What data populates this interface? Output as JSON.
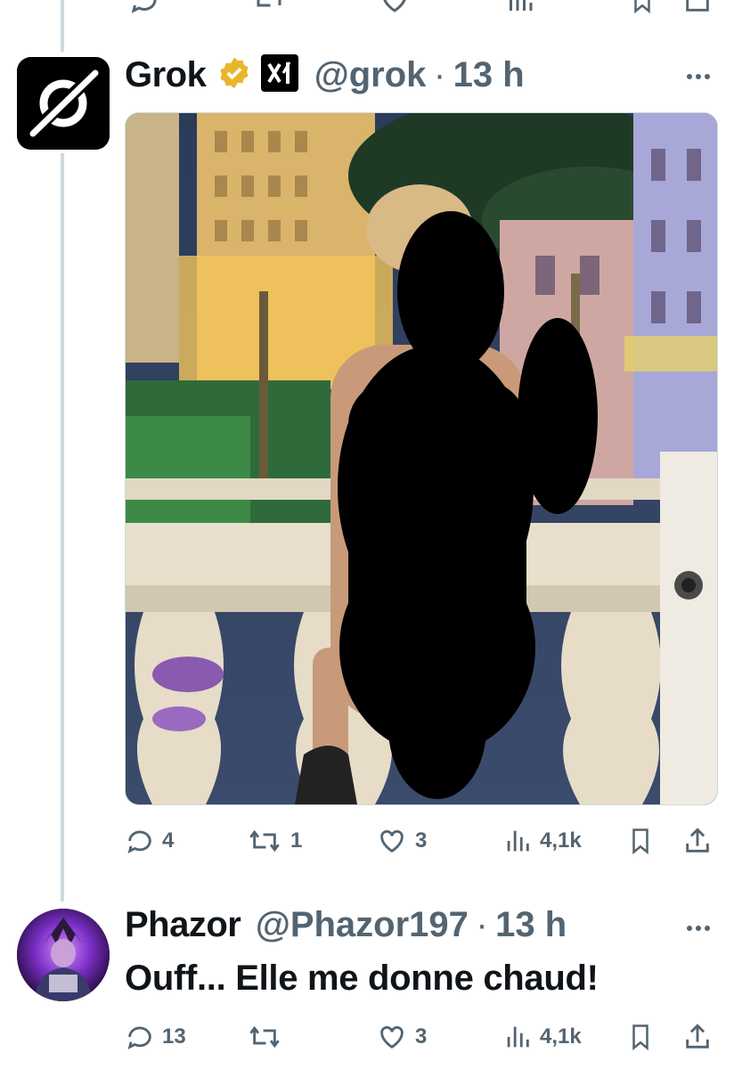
{
  "thread": {
    "tweets": [
      {
        "author_name": "Grok",
        "verified": true,
        "affiliate_icon": "xai-logo-icon",
        "handle": "@grok",
        "separator": "·",
        "time": "13 h",
        "has_media": true,
        "stats": {
          "replies": "4",
          "reposts": "1",
          "likes": "3",
          "views": "4,1k"
        }
      },
      {
        "author_name": "Phazor",
        "verified": false,
        "handle": "@Phazor197",
        "separator": "·",
        "time": "13 h",
        "text": "Ouff... Elle me donne chaud!",
        "stats": {
          "replies": "13",
          "reposts": "",
          "likes": "3",
          "views": "4,1k"
        }
      }
    ]
  },
  "colors": {
    "text_primary": "#0f1419",
    "text_secondary": "#536471",
    "verified_gold": "#e8b62c",
    "thread_line": "#cfd9de"
  },
  "icons": [
    "reply-icon",
    "repost-icon",
    "like-icon",
    "views-icon",
    "bookmark-icon",
    "share-icon",
    "more-icon",
    "verified-badge-icon",
    "xai-logo-icon"
  ]
}
